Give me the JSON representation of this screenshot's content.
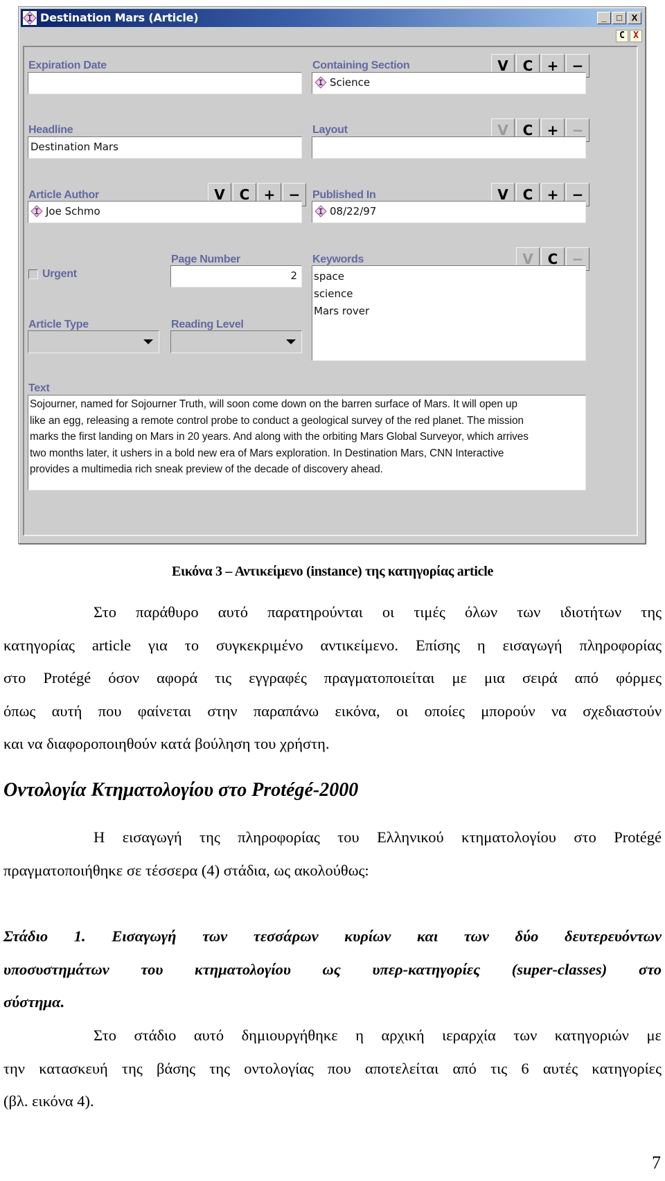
{
  "window": {
    "title": "Destination Mars (Article)",
    "controls": {
      "minimize": "_",
      "maximize": "□",
      "close": "X"
    },
    "form_controls": {
      "customize": "C",
      "close": "X"
    }
  },
  "form": {
    "expiration_date": {
      "label": "Expiration Date",
      "value": ""
    },
    "containing_section": {
      "label": "Containing Section",
      "value": "Science",
      "buttons": [
        "V",
        "C",
        "+",
        "−"
      ],
      "disabled": []
    },
    "headline": {
      "label": "Headline",
      "value": "Destination Mars"
    },
    "layout": {
      "label": "Layout",
      "value": "",
      "buttons": [
        "V",
        "C",
        "+",
        "−"
      ],
      "disabled": [
        "V",
        "−"
      ]
    },
    "article_author": {
      "label": "Article Author",
      "value": "Joe Schmo",
      "buttons": [
        "V",
        "C",
        "+",
        "−"
      ],
      "disabled": []
    },
    "published_in": {
      "label": "Published In",
      "value": "08/22/97",
      "buttons": [
        "V",
        "C",
        "+",
        "−"
      ],
      "disabled": []
    },
    "urgent": {
      "label": "Urgent",
      "checked": false
    },
    "page_number": {
      "label": "Page Number",
      "value": "2"
    },
    "keywords": {
      "label": "Keywords",
      "values": [
        "space",
        "science",
        "Mars rover"
      ],
      "buttons": [
        "V",
        "C",
        "−"
      ],
      "disabled": [
        "V",
        "−"
      ]
    },
    "article_type": {
      "label": "Article Type",
      "value": ""
    },
    "reading_level": {
      "label": "Reading Level",
      "value": ""
    },
    "text": {
      "label": "Text",
      "lines": [
        "Sojourner, named for Sojourner Truth, will soon come down on the barren surface of Mars. It will open up",
        "like an egg, releasing a remote control probe to conduct a geological survey of the red planet. The mission",
        "marks the first landing on Mars in 20 years. And along with the orbiting Mars Global Surveyor, which arrives",
        "two months later, it ushers in a bold new era of Mars exploration.  In Destination Mars, CNN Interactive",
        "provides a multimedia rich sneak preview of the decade of discovery ahead."
      ]
    }
  },
  "document": {
    "caption": "Εικόνα 3 – Αντικείμενο (instance) της κατηγορίας article",
    "paragraph1": [
      "Στο παράθυρο αυτό παρατηρούνται οι τιμές όλων των ιδιοτήτων της",
      "κατηγορίας article για το συγκεκριμένο αντικείμενο. Επίσης η εισαγωγή πληροφορίας",
      "στο Protégé όσον αφορά τις εγγραφές πραγματοποιείται με μια σειρά από φόρμες",
      "όπως αυτή που φαίνεται στην παραπάνω εικόνα, οι οποίες μπορούν να σχεδιαστούν",
      "και να διαφοροποιηθούν κατά βούληση του χρήστη."
    ],
    "heading": "Οντολογία Κτηματολογίου στο Protégé-2000",
    "paragraph2": [
      "Η εισαγωγή της πληροφορίας του Ελληνικού κτηματολογίου στο Protégé",
      "πραγματοποιήθηκε σε τέσσερα (4) στάδια, ως ακολούθως:"
    ],
    "stage1": [
      "Στάδιο 1. Εισαγωγή των τεσσάρων κυρίων και των δύο δευτερευόντων",
      "υποσυστημάτων του κτηματολογίου ως υπερ-κατηγορίες (super-classes) στο",
      "σύστημα."
    ],
    "paragraph3": [
      "Στο στάδιο αυτό δημιουργήθηκε η αρχική ιεραρχία των κατηγοριών με",
      "την κατασκευή της βάσης της οντολογίας που αποτελείται από τις 6 αυτές κατηγορίες",
      "(βλ. εικόνα 4)."
    ],
    "page_number": "7"
  },
  "colors": {
    "title_bar_start": "#0a246a",
    "title_bar_end": "#a6caf0",
    "label": "#6369a0",
    "panel_bg": "#cdcdcd",
    "instance_icon": "#f0c8ee"
  }
}
